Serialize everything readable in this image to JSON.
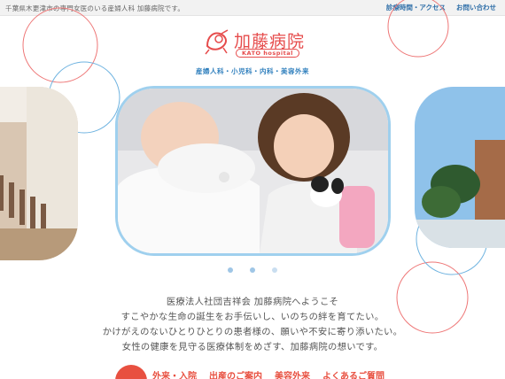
{
  "topbar": {
    "tagline": "千葉県木更津市の専門女医のいる産婦人科 加藤病院です。",
    "links": [
      "診療時間・アクセス",
      "お問い合わせ"
    ]
  },
  "logo": {
    "name": "加藤病院",
    "sub": "KATO hospital"
  },
  "departments": "産婦人科・小児科・内科・美容外来",
  "slider": {
    "hero_alt": "baby-and-girl-photo",
    "dots": 3,
    "active_index": 0
  },
  "greeting": {
    "lines": [
      "医療法人社団吉祥会 加藤病院へようこそ",
      "すこやかな生命の誕生をお手伝いし、いのちの絆を育てたい。",
      "かけがえのないひとりひとりの患者様の、願いや不安に寄り添いたい。",
      "女性の健康を見守る医療体制をめざす、加藤病院の想いです。"
    ]
  },
  "bottom_nav": [
    "外来・入院",
    "出産のご案内",
    "美容外来",
    "よくあるご質問"
  ],
  "colors": {
    "accent_red": "#e64c4c",
    "accent_blue": "#2f7fbd",
    "frame_blue": "#9fd0ee"
  }
}
